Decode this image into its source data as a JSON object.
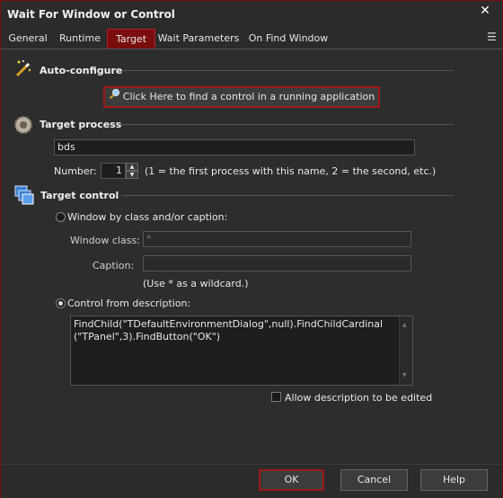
{
  "window": {
    "title": "Wait For Window or Control",
    "close_glyph": "✕"
  },
  "tabs": [
    {
      "label": "General"
    },
    {
      "label": "Runtime"
    },
    {
      "label": "Target"
    },
    {
      "label": "Wait Parameters"
    },
    {
      "label": "On Find Window"
    }
  ],
  "tab_menu_glyph": "☰",
  "auto_configure": {
    "title": "Auto-configure",
    "button_label": "Click Here to find a control in a running application",
    "icon": "magic-wand-icon",
    "button_icon": "magnifier-icon"
  },
  "target_process": {
    "title": "Target process",
    "icon": "gear-icon",
    "process_value": "bds",
    "number_label": "Number:",
    "number_value": "1",
    "number_hint": "(1 = the first process with this name, 2 = the second, etc.)"
  },
  "target_control": {
    "title": "Target control",
    "icon": "windows-stack-icon",
    "radio_class_label": "Window by class and/or caption:",
    "window_class_label": "Window class:",
    "window_class_value": "*",
    "caption_label": "Caption:",
    "caption_value": "",
    "wildcard_hint": "(Use * as a wildcard.)",
    "radio_desc_label": "Control from description:",
    "description_line1": "FindChild(\"TDefaultEnvironmentDialog\",null).FindChildCardinal",
    "description_line2": "(\"TPanel\",3).FindButton(\"OK\")",
    "allow_edit_label": "Allow description to be edited"
  },
  "footer": {
    "ok_label": "OK",
    "cancel_label": "Cancel",
    "help_label": "Help"
  },
  "colors": {
    "accent": "#7a0d0d",
    "background": "#2d2d2d"
  }
}
